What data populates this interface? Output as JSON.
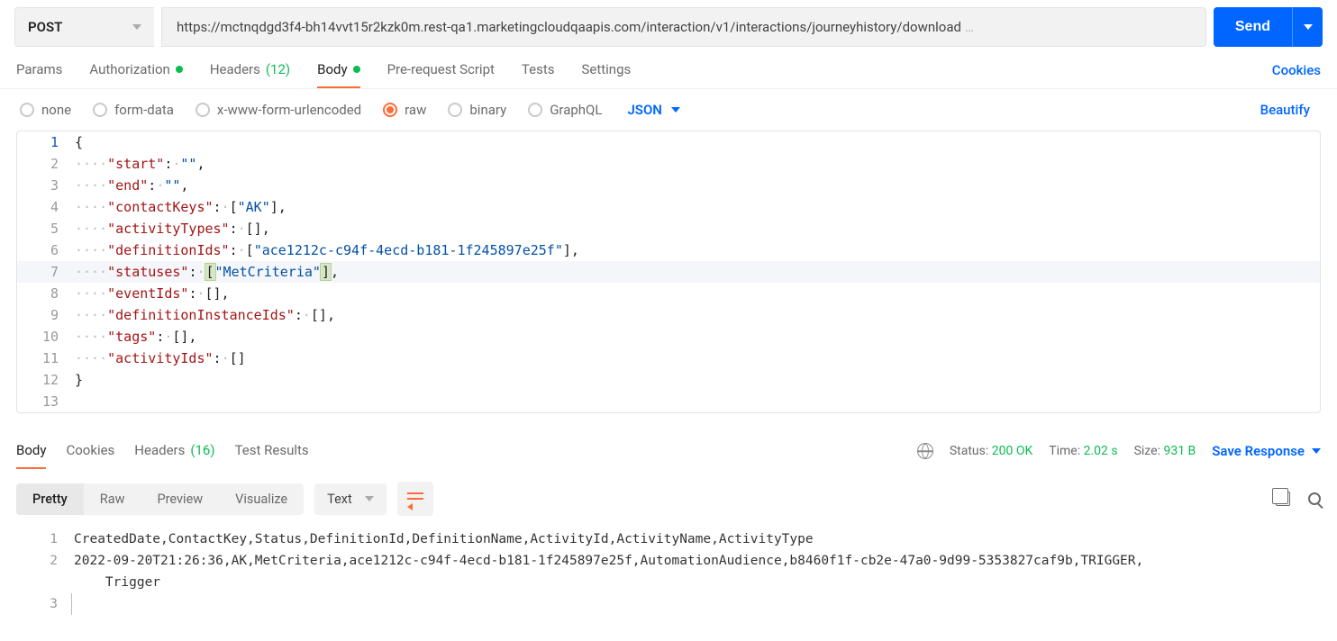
{
  "request": {
    "method": "POST",
    "url": "https://mctnqdgd3f4-bh14vvt15r2kzk0m.rest-qa1.marketingcloudqaapis.com/interaction/v1/interactions/journeyhistory/download",
    "send_label": "Send"
  },
  "tabs": {
    "params": "Params",
    "authorization": "Authorization",
    "headers": "Headers",
    "headers_count": "(12)",
    "body": "Body",
    "prerequest": "Pre-request Script",
    "tests": "Tests",
    "settings": "Settings",
    "cookies": "Cookies"
  },
  "body_types": {
    "none": "none",
    "form_data": "form-data",
    "urlencoded": "x-www-form-urlencoded",
    "raw": "raw",
    "binary": "binary",
    "graphql": "GraphQL",
    "language": "JSON",
    "beautify": "Beautify"
  },
  "editor": {
    "line1": "{",
    "line2_key": "\"start\"",
    "line2_val": "\"\"",
    "line3_key": "\"end\"",
    "line3_val": "\"\"",
    "line4_key": "\"contactKeys\"",
    "line4_val": "\"AK\"",
    "line5_key": "\"activityTypes\"",
    "line6_key": "\"definitionIds\"",
    "line6_val": "\"ace1212c-c94f-4ecd-b181-1f245897e25f\"",
    "line7_key": "\"statuses\"",
    "line7_val": "\"MetCriteria\"",
    "line8_key": "\"eventIds\"",
    "line9_key": "\"definitionInstanceIds\"",
    "line10_key": "\"tags\"",
    "line11_key": "\"activityIds\"",
    "line12": "}"
  },
  "response_tabs": {
    "body": "Body",
    "cookies": "Cookies",
    "headers": "Headers",
    "headers_count": "(16)",
    "test_results": "Test Results"
  },
  "response_meta": {
    "status_label": "Status:",
    "status_value": "200 OK",
    "time_label": "Time:",
    "time_value": "2.02 s",
    "size_label": "Size:",
    "size_value": "931 B",
    "save_response": "Save Response"
  },
  "format": {
    "pretty": "Pretty",
    "raw": "Raw",
    "preview": "Preview",
    "visualize": "Visualize",
    "lang": "Text"
  },
  "response_body": {
    "line1": "CreatedDate,ContactKey,Status,DefinitionId,DefinitionName,ActivityId,ActivityName,ActivityType",
    "line2a": "2022-09-20T21:26:36,AK,MetCriteria,ace1212c-c94f-4ecd-b181-1f245897e25f,AutomationAudience,b8460f1f-cb2e-47a0-9d99-5353827caf9b,TRIGGER,",
    "line2b": "    Trigger"
  }
}
